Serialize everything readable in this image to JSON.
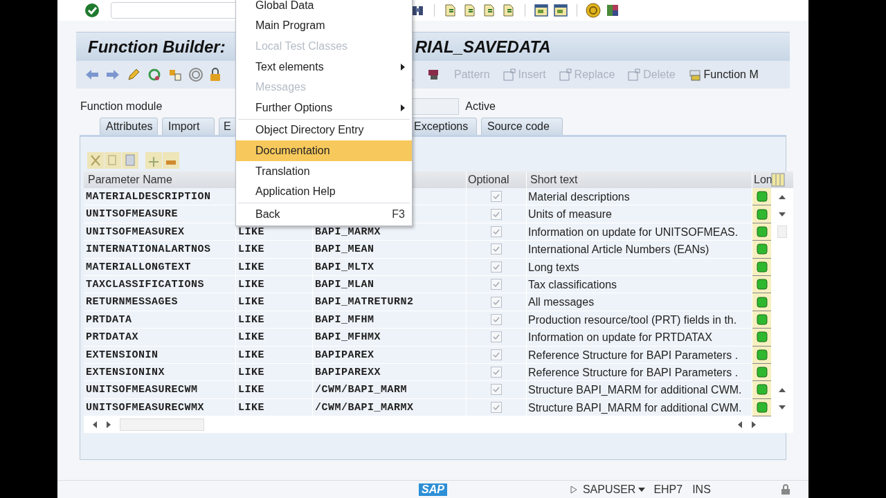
{
  "title": {
    "left": "Function Builder:",
    "right": "RIAL_SAVEDATA"
  },
  "app_toolbar": [
    {
      "label": "Pattern",
      "disabled": true
    },
    {
      "label": "Insert",
      "disabled": true
    },
    {
      "label": "Replace",
      "disabled": true
    },
    {
      "label": "Delete",
      "disabled": true
    },
    {
      "label": "Function M",
      "disabled": false
    }
  ],
  "header": {
    "label": "Function module",
    "status": "Active"
  },
  "tabs": [
    {
      "label": "Attributes"
    },
    {
      "label": "Import"
    },
    {
      "label": "E"
    },
    {
      "label": "Exceptions"
    },
    {
      "label": "Source code"
    }
  ],
  "menu": [
    {
      "kind": "item",
      "label": "Global Data",
      "disabled": false,
      "submenu": false,
      "selected": false
    },
    {
      "kind": "item",
      "label": "Main Program",
      "disabled": false,
      "submenu": false,
      "selected": false
    },
    {
      "kind": "item",
      "label": "Local Test Classes",
      "disabled": true,
      "submenu": false,
      "selected": false
    },
    {
      "kind": "item",
      "label": "Text elements",
      "disabled": false,
      "submenu": true,
      "selected": false
    },
    {
      "kind": "item",
      "label": "Messages",
      "disabled": true,
      "submenu": false,
      "selected": false
    },
    {
      "kind": "item",
      "label": "Further Options",
      "disabled": false,
      "submenu": true,
      "selected": false
    },
    {
      "kind": "separator"
    },
    {
      "kind": "item",
      "label": "Object Directory Entry",
      "disabled": false,
      "submenu": false,
      "selected": false
    },
    {
      "kind": "item",
      "label": "Documentation",
      "disabled": false,
      "submenu": false,
      "selected": true
    },
    {
      "kind": "item",
      "label": "Translation",
      "disabled": false,
      "submenu": false,
      "selected": false
    },
    {
      "kind": "item",
      "label": "Application Help",
      "disabled": false,
      "submenu": false,
      "selected": false
    },
    {
      "kind": "separator"
    },
    {
      "kind": "item",
      "label": "Back",
      "shortcut": "F3",
      "disabled": false,
      "submenu": false,
      "selected": false
    }
  ],
  "table": {
    "columns": [
      "Parameter Name",
      "Optional",
      "Short text",
      "Lon"
    ],
    "rows": [
      {
        "name": "MATERIALDESCRIPTION",
        "optional": true,
        "short_text": "Material descriptions"
      },
      {
        "name": "UNITSOFMEASURE",
        "optional": true,
        "short_text": "Units of measure"
      },
      {
        "name": "UNITSOFMEASUREX",
        "typing": "LIKE",
        "type": "BAPI_MARMX",
        "optional": true,
        "short_text": "Information on update for UNITSOFMEAS."
      },
      {
        "name": "INTERNATIONALARTNOS",
        "typing": "LIKE",
        "type": "BAPI_MEAN",
        "optional": true,
        "short_text": "International Article Numbers (EANs)"
      },
      {
        "name": "MATERIALLONGTEXT",
        "typing": "LIKE",
        "type": "BAPI_MLTX",
        "optional": true,
        "short_text": "Long texts"
      },
      {
        "name": "TAXCLASSIFICATIONS",
        "typing": "LIKE",
        "type": "BAPI_MLAN",
        "optional": true,
        "short_text": "Tax classifications"
      },
      {
        "name": "RETURNMESSAGES",
        "typing": "LIKE",
        "type": "BAPI_MATRETURN2",
        "optional": true,
        "short_text": "All messages"
      },
      {
        "name": "PRTDATA",
        "typing": "LIKE",
        "type": "BAPI_MFHM",
        "optional": true,
        "short_text": "Production resource/tool (PRT) fields in th."
      },
      {
        "name": "PRTDATAX",
        "typing": "LIKE",
        "type": "BAPI_MFHMX",
        "optional": true,
        "short_text": "Information on update for PRTDATAX"
      },
      {
        "name": "EXTENSIONIN",
        "typing": "LIKE",
        "type": "BAPIPAREX",
        "optional": true,
        "short_text": "Reference Structure for BAPI Parameters ."
      },
      {
        "name": "EXTENSIONINX",
        "typing": "LIKE",
        "type": "BAPIPAREXX",
        "optional": true,
        "short_text": "Reference Structure for BAPI Parameters ."
      },
      {
        "name": "UNITSOFMEASURECWM",
        "typing": "LIKE",
        "type": "/CWM/BAPI_MARM",
        "optional": true,
        "short_text": "Structure BAPI_MARM for additional CWM."
      },
      {
        "name": "UNITSOFMEASURECWMX",
        "typing": "LIKE",
        "type": "/CWM/BAPI_MARMX",
        "optional": true,
        "short_text": "Structure BAPI_MARM for additional CWM."
      }
    ]
  },
  "status_bar": {
    "logo": "SAP",
    "user": "SAPUSER",
    "system": "EHP7",
    "mode": "INS"
  }
}
